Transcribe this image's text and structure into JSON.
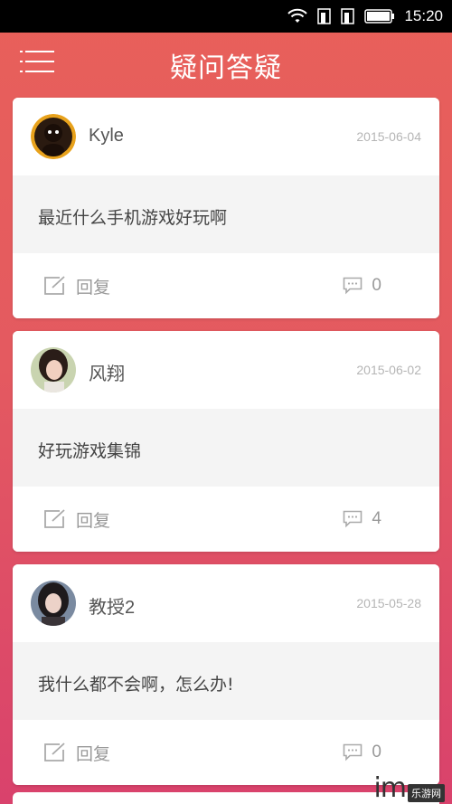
{
  "status_bar": {
    "time": "15:20",
    "icons": [
      "wifi-icon",
      "sim1-icon",
      "sim2-icon",
      "battery-icon"
    ]
  },
  "app_bar": {
    "title": "疑问答疑",
    "menu_icon": "hamburger-menu-icon"
  },
  "posts": [
    {
      "username": "Kyle",
      "date": "2015-06-04",
      "question": "最近什么手机游戏好玩啊",
      "reply_label": "回复",
      "comment_count": "0"
    },
    {
      "username": "风翔",
      "date": "2015-06-02",
      "question": "好玩游戏集锦",
      "reply_label": "回复",
      "comment_count": "4"
    },
    {
      "username": "教授2",
      "date": "2015-05-28",
      "question": "我什么都不会啊，怎么办!",
      "reply_label": "回复",
      "comment_count": "0"
    }
  ],
  "watermark": {
    "prefix": "im",
    "badge": "乐游网"
  },
  "colors": {
    "header_gradient_top": "#e8605a",
    "header_gradient_bottom": "#d9426c",
    "card_body_bg": "#f4f4f4",
    "date_text": "#b5b5b5"
  }
}
